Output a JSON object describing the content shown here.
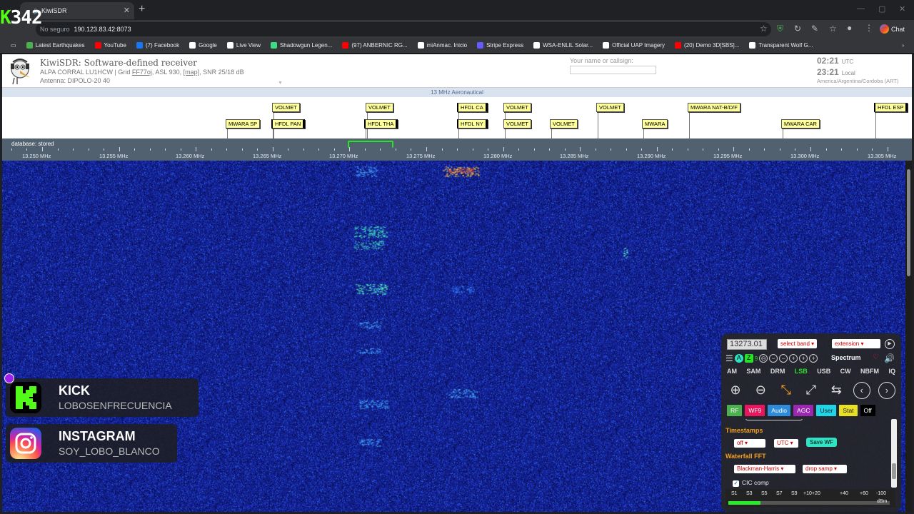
{
  "browser": {
    "tab_title": "KiwiSDR",
    "url_security": "No seguro",
    "url": "190.123.83.42:8073",
    "chat_label": "Chat",
    "bookmarks": [
      {
        "label": "Latest Earthquakes",
        "color": "#4caf50"
      },
      {
        "label": "YouTube",
        "color": "#ff0000"
      },
      {
        "label": "(7) Facebook",
        "color": "#1877f2"
      },
      {
        "label": "Google",
        "color": "#ffffff"
      },
      {
        "label": "Live View",
        "color": "#ffffff"
      },
      {
        "label": "Shadowgun Legen...",
        "color": "#3ddc84"
      },
      {
        "label": "(97) ANBERNIC RG...",
        "color": "#ff0000"
      },
      {
        "label": "miAnmac. Inicio",
        "color": "#ffffff"
      },
      {
        "label": "Stripe Express",
        "color": "#635bff"
      },
      {
        "label": "WSA-ENLIL Solar...",
        "color": "#ffffff"
      },
      {
        "label": "Official UAP Imagery",
        "color": "#ffffff"
      },
      {
        "label": "(20) Demo 3D[SBS]...",
        "color": "#ff0000"
      },
      {
        "label": "Transparent Wolf G...",
        "color": "#ffffff"
      }
    ]
  },
  "overlay": {
    "counter_prefix": "K",
    "counter_value": "342",
    "kick_title": "KICK",
    "kick_user": "LOBOSENFRECUENCIA",
    "instagram_title": "INSTAGRAM",
    "instagram_user": "SOY_LOBO_BLANCO"
  },
  "kiwi": {
    "title": "KiwiSDR: Software-defined receiver",
    "info_prefix": "ALPA CORRAL LU1HCW | Grid ",
    "grid": "FF77oj",
    "info_mid": ", ASL 930, ",
    "map_link": "[map]",
    "info_suffix": ", SNR 25/18 dB",
    "antenna": "Antenna: DIPOLO-20 40",
    "callsign_label": "Your name or callsign:",
    "time_utc": "02:21",
    "utc_label": "UTC",
    "time_local": "23:21",
    "local_label": "Local",
    "timezone": "America/Argentina/Cordoba (ART)",
    "band_name": "13 MHz Aeronautical",
    "database_label": "database: stored",
    "freq_ticks": [
      "13.250 MHz",
      "13.255 MHz",
      "13.260 MHz",
      "13.265 MHz",
      "13.270 MHz",
      "13.275 MHz",
      "13.280 MHz",
      "13.285 MHz",
      "13.290 MHz",
      "13.295 MHz",
      "13.300 MHz",
      "13.305 MHz"
    ],
    "labels_top": [
      "VOLMET",
      "VOLMET",
      "HFDL CA",
      "VOLMET",
      "VOLMET",
      "MWARA NAT-B/D/F",
      "HFDL ESP"
    ],
    "labels_bottom": [
      "MWARA SP",
      "HFDL PAN",
      "HFDL THA",
      "HFDL NY",
      "VOLMET",
      "VOLMET",
      "MWARA",
      "MWARA CAR"
    ]
  },
  "control": {
    "frequency": "13273.01",
    "band_select": "select band",
    "extension_select": "extension",
    "spectrum_label": "Spectrum",
    "modes": [
      "AM",
      "SAM",
      "DRM",
      "LSB",
      "USB",
      "CW",
      "NBFM",
      "IQ"
    ],
    "active_mode": "LSB",
    "tabs": [
      {
        "label": "RF",
        "color": "#4caf50"
      },
      {
        "label": "WF9",
        "color": "#e8175d"
      },
      {
        "label": "Audio",
        "color": "#2e8bda"
      },
      {
        "label": "AGC",
        "color": "#9c27b0"
      },
      {
        "label": "User",
        "color": "#1fd5e8"
      },
      {
        "label": "Stat",
        "color": "#e8e024"
      },
      {
        "label": "Off",
        "color": "#000000"
      }
    ],
    "timestamps_heading": "Timestamps",
    "timestamps_value": "off",
    "timezone_value": "UTC",
    "save_wf": "Save WF",
    "fft_heading": "Waterfall FFT",
    "window_value": "Blackman-Harris",
    "samp_value": "drop samp",
    "cic_label": "CIC comp",
    "smeter_labels": [
      "S1",
      "S3",
      "S5",
      "S7",
      "S9",
      "+10",
      "+20",
      "+40",
      "+60",
      "-100"
    ],
    "smeter_unit": "dBm",
    "smeter_level": 0.2
  }
}
